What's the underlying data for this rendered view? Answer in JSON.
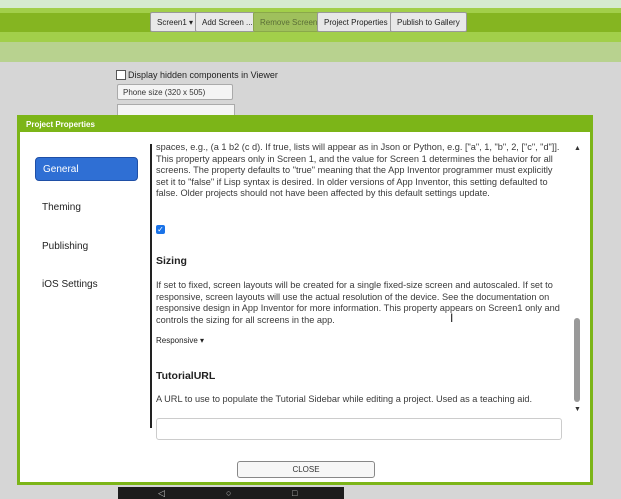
{
  "toolbar": {
    "screen_label": "Screen1 ▾",
    "add_screen": "Add Screen ...",
    "remove_screen": "Remove Screen",
    "project_properties": "Project Properties",
    "publish": "Publish to Gallery"
  },
  "viewer": {
    "hidden_components": "Display hidden components in Viewer",
    "phone_size": "Phone size (320 x 505)"
  },
  "dialog": {
    "title": "Project Properties",
    "sidebar": [
      {
        "label": "General",
        "active": true
      },
      {
        "label": "Theming",
        "active": false
      },
      {
        "label": "Publishing",
        "active": false
      },
      {
        "label": "iOS Settings",
        "active": false
      }
    ],
    "lisp_paragraph": "spaces, e.g., (a 1 b2 (c d). If true, lists will appear as in Json or Python, e.g. [\"a\", 1, \"b\", 2, [\"c\", \"d\"]]. This property appears only in Screen 1, and the value for Screen 1 determines the behavior for all screens. The property defaults to \"true\" meaning that the App Inventor programmer must explicitly set it to \"false\" if Lisp syntax is desired. In older versions of App Inventor, this setting defaulted to false. Older projects should not have been affected by this default settings update.",
    "sizing_heading": "Sizing",
    "sizing_paragraph": "If set to fixed, screen layouts will be created for a single fixed-size screen and autoscaled. If set to responsive, screen layouts will use the actual resolution of the device. See the documentation on responsive design in App Inventor for more information. This property appears on Screen1 only and controls the sizing for all screens in the app.",
    "sizing_value": "Responsive ▾",
    "tutorial_heading": "TutorialURL",
    "tutorial_paragraph": "A URL to use to populate the Tutorial Sidebar while editing a project. Used as a teaching aid.",
    "tutorial_value": "",
    "close_label": "CLOSE"
  },
  "colors": {
    "accent_green": "#7cb518",
    "active_blue": "#2f6fd4"
  }
}
